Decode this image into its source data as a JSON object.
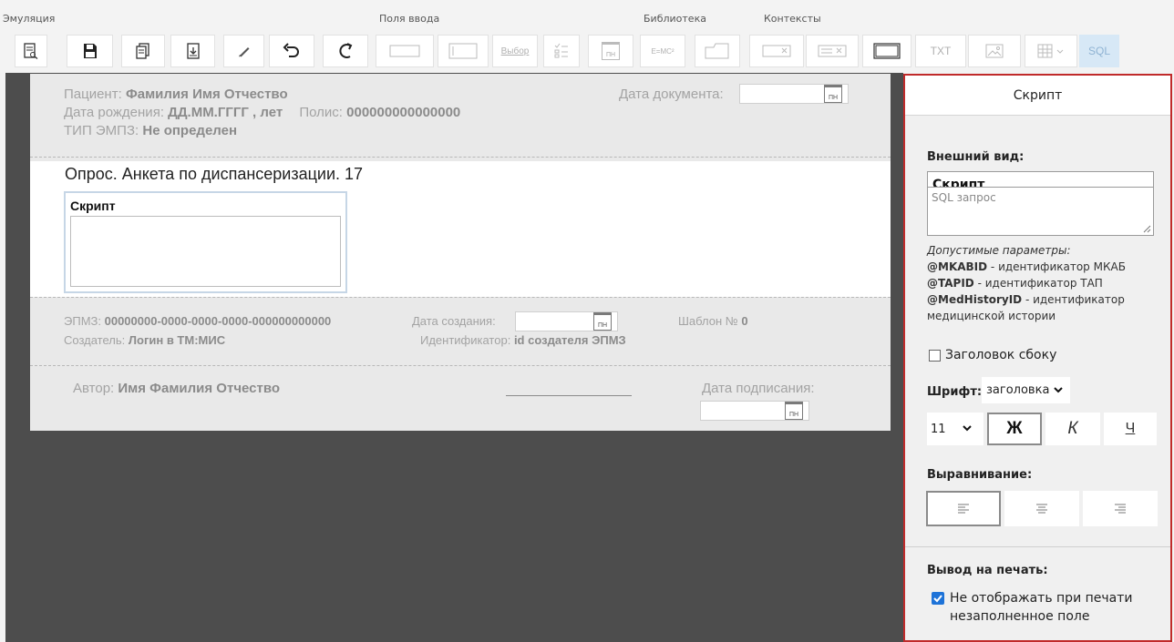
{
  "toolbar": {
    "groups": {
      "emulation": "Эмуляция",
      "inputs": "Поля ввода",
      "library": "Библиотека",
      "contexts": "Контексты"
    },
    "select_label": "Выбор",
    "formula_label": "E=MC²",
    "txt_label": "TXT",
    "sql_label": "SQL",
    "calendar_glyph": "ПН"
  },
  "document": {
    "patient_label": "Пациент:",
    "patient_value": "Фамилия Имя Отчество",
    "birth_label": "Дата рождения:",
    "birth_value": "ДД.ММ.ГГГГ , лет",
    "policy_label": "Полис:",
    "policy_value": "000000000000000",
    "type_label": "ТИП ЭМПЗ:",
    "type_value": "Не определен",
    "doc_date_label": "Дата документа:",
    "title": "Опрос. Анкета по диспансеризации. 17",
    "script_label": "Скрипт",
    "empz_label": "ЭПМЗ:",
    "empz_value": "00000000-0000-0000-0000-000000000000",
    "created_label": "Дата создания:",
    "template_label": "Шаблон №",
    "template_value": "0",
    "creator_label": "Создатель:",
    "creator_value": "Логин в ТМ:МИС",
    "identifier_label": "Идентификатор:",
    "identifier_value": "id создателя ЭПМЗ",
    "author_label": "Автор:",
    "author_value": "Имя Фамилия Отчество",
    "signed_label": "Дата подписания:"
  },
  "panel": {
    "title": "Скрипт",
    "appearance_label": "Внешний вид:",
    "name_value": "Скрипт",
    "sql_placeholder": "SQL запрос",
    "params_heading": "Допустимые параметры:",
    "params": [
      {
        "name": "@MKABID",
        "desc": " - идентификатор МКАБ"
      },
      {
        "name": "@TAPID",
        "desc": " - идентификатор ТАП"
      },
      {
        "name": "@MedHistoryID",
        "desc": " - идентификатор"
      }
    ],
    "params_tail": "медицинской истории",
    "side_header_label": "Заголовок сбоку",
    "side_header_checked": false,
    "font_label": "Шрифт:",
    "font_value": "заголовка",
    "size_value": "11",
    "bold_label": "Ж",
    "italic_label": "К",
    "underline_label": "Ч",
    "align_label": "Выравнивание:",
    "print_label": "Вывод на печать:",
    "print_option_line1": "Не отображать при печати",
    "print_option_line2": "незаполненное поле",
    "print_option_checked": true,
    "accent_color": "#c02a2a",
    "checkbox_color": "#1e73d8"
  }
}
